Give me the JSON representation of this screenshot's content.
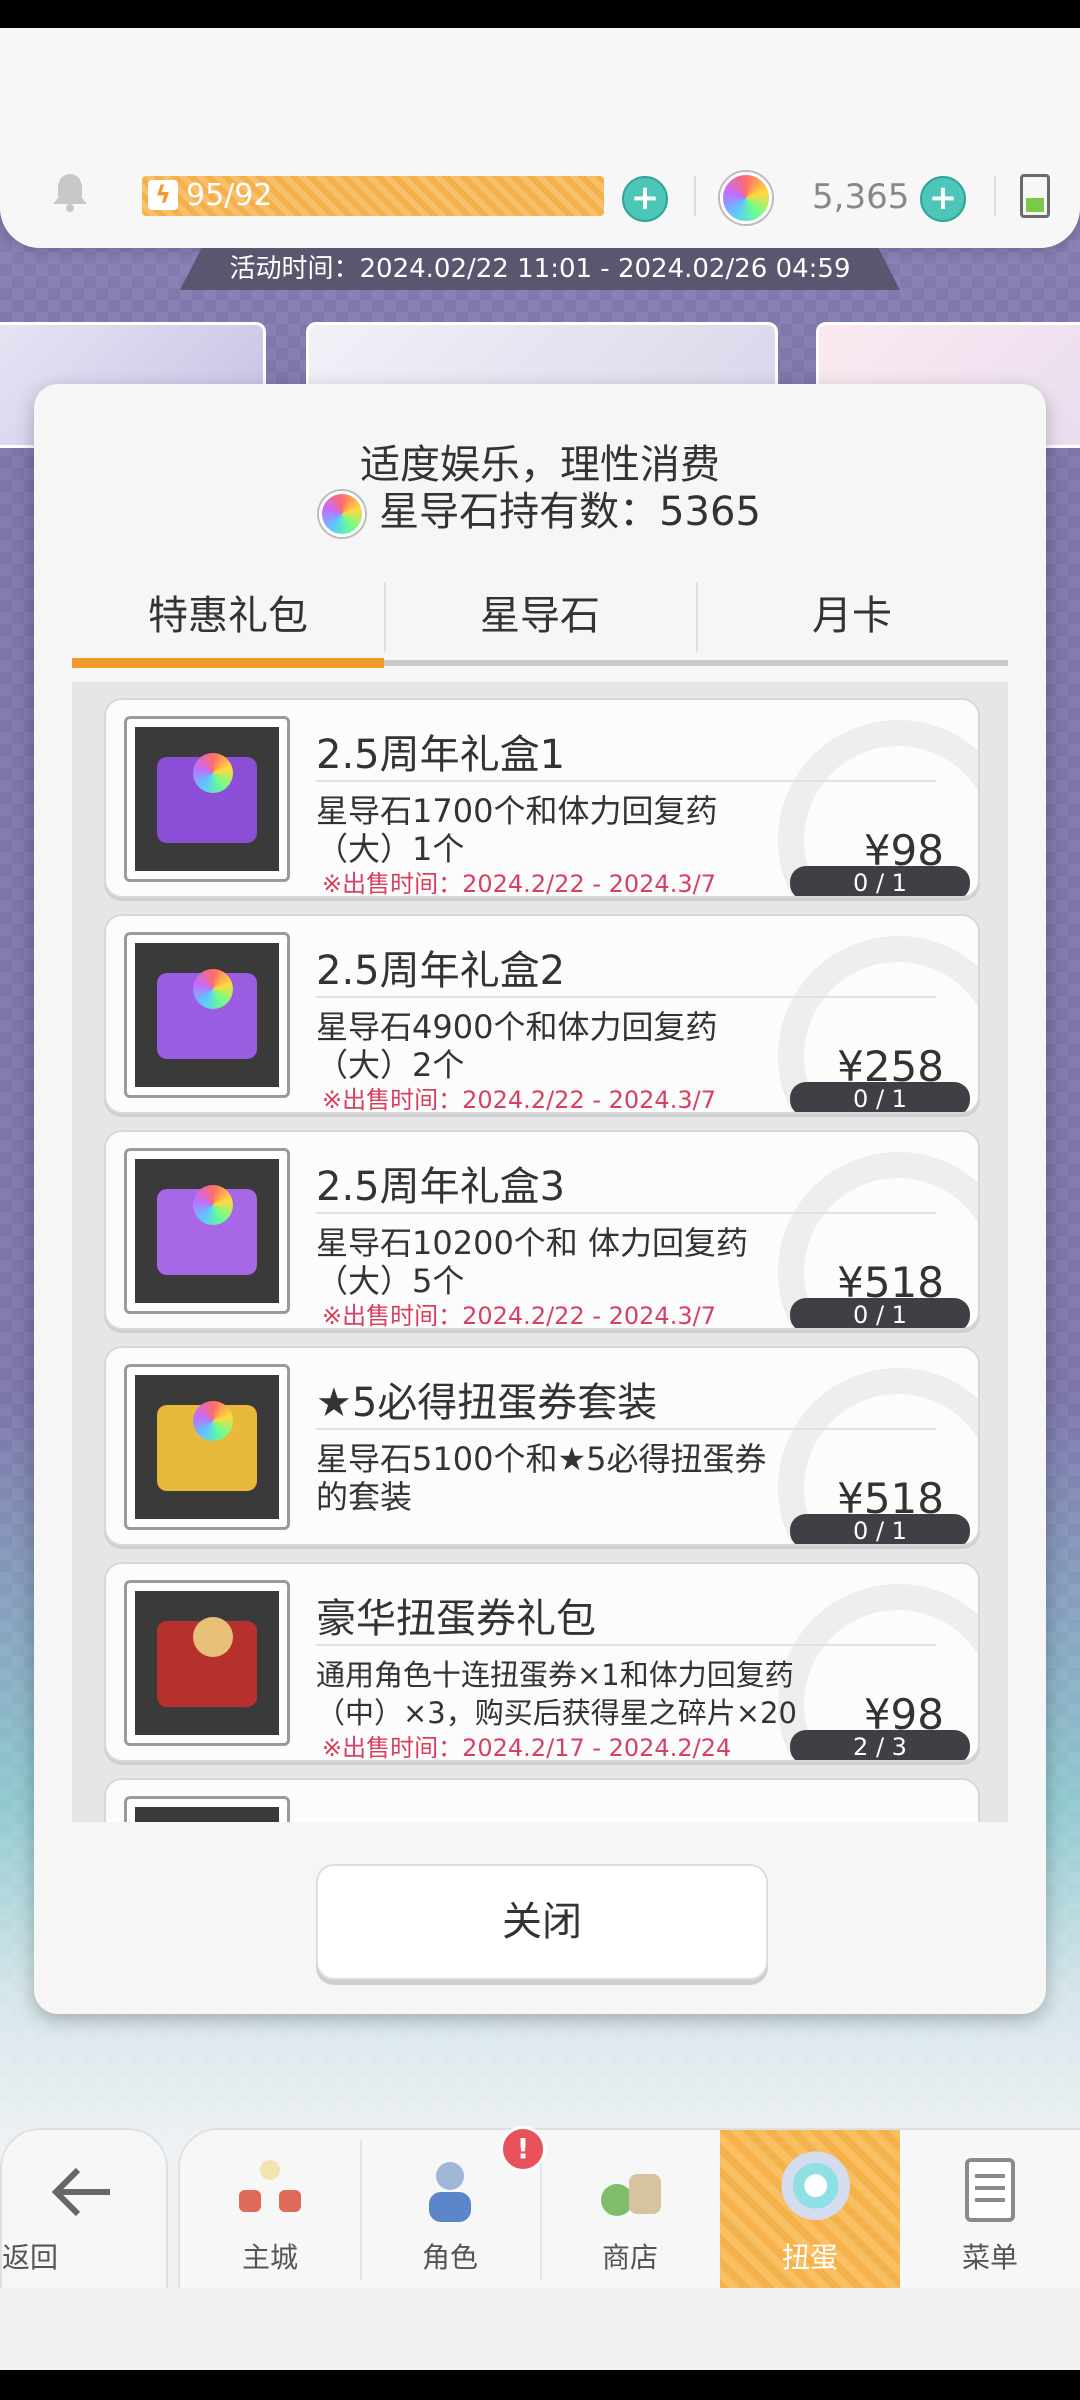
{
  "topbar": {
    "stamina": "95/92",
    "gem_count": "5,365",
    "event_time": "活动时间：2024.02/22 11:01 - 2024.02/26 04:59"
  },
  "dialog": {
    "notice": "适度娱乐，理性消费",
    "gem_holding": "星导石持有数：5365",
    "tabs": [
      {
        "label": "特惠礼包",
        "active": true
      },
      {
        "label": "星导石",
        "active": false
      },
      {
        "label": "月卡",
        "active": false
      }
    ],
    "items": [
      {
        "title": "2.5周年礼盒1",
        "desc": "星导石1700个和体力回复药（大）1个",
        "sale_time": "※出售时间：2024.2/22 - 2024.3/7",
        "price": "¥98",
        "limit": "0 / 1"
      },
      {
        "title": "2.5周年礼盒2",
        "desc": "星导石4900个和体力回复药（大）2个",
        "sale_time": "※出售时间：2024.2/22 - 2024.3/7",
        "price": "¥258",
        "limit": "0 / 1"
      },
      {
        "title": "2.5周年礼盒3",
        "desc": "星导石10200个和 体力回复药（大）5个",
        "sale_time": "※出售时间：2024.2/22 - 2024.3/7",
        "price": "¥518",
        "limit": "0 / 1"
      },
      {
        "title": "★5必得扭蛋券套装",
        "desc": "星导石5100个和★5必得扭蛋券的套装",
        "sale_time": "",
        "price": "¥518",
        "limit": "0 / 1"
      },
      {
        "title": "豪华扭蛋券礼包",
        "desc": "通用角色十连扭蛋券×1和体力回复药（中）×3，购买后获得星之碎片×20",
        "sale_time": "※出售时间：2024.2/17 - 2024.2/24",
        "price": "¥98",
        "limit": "2 / 3"
      }
    ],
    "close_label": "关闭"
  },
  "nav": {
    "back_label": "返回",
    "items": [
      {
        "label": "主城",
        "icon": "castle-icon"
      },
      {
        "label": "角色",
        "icon": "character-icon"
      },
      {
        "label": "商店",
        "icon": "shop-icon"
      },
      {
        "label": "扭蛋",
        "icon": "gacha-icon",
        "active": true
      },
      {
        "label": "菜单",
        "icon": "menu-icon"
      }
    ],
    "alert_badge": "!"
  },
  "colors": {
    "accent_orange": "#f39a2a",
    "sale_red": "#d94060",
    "plus_teal": "#4cc6b8"
  }
}
